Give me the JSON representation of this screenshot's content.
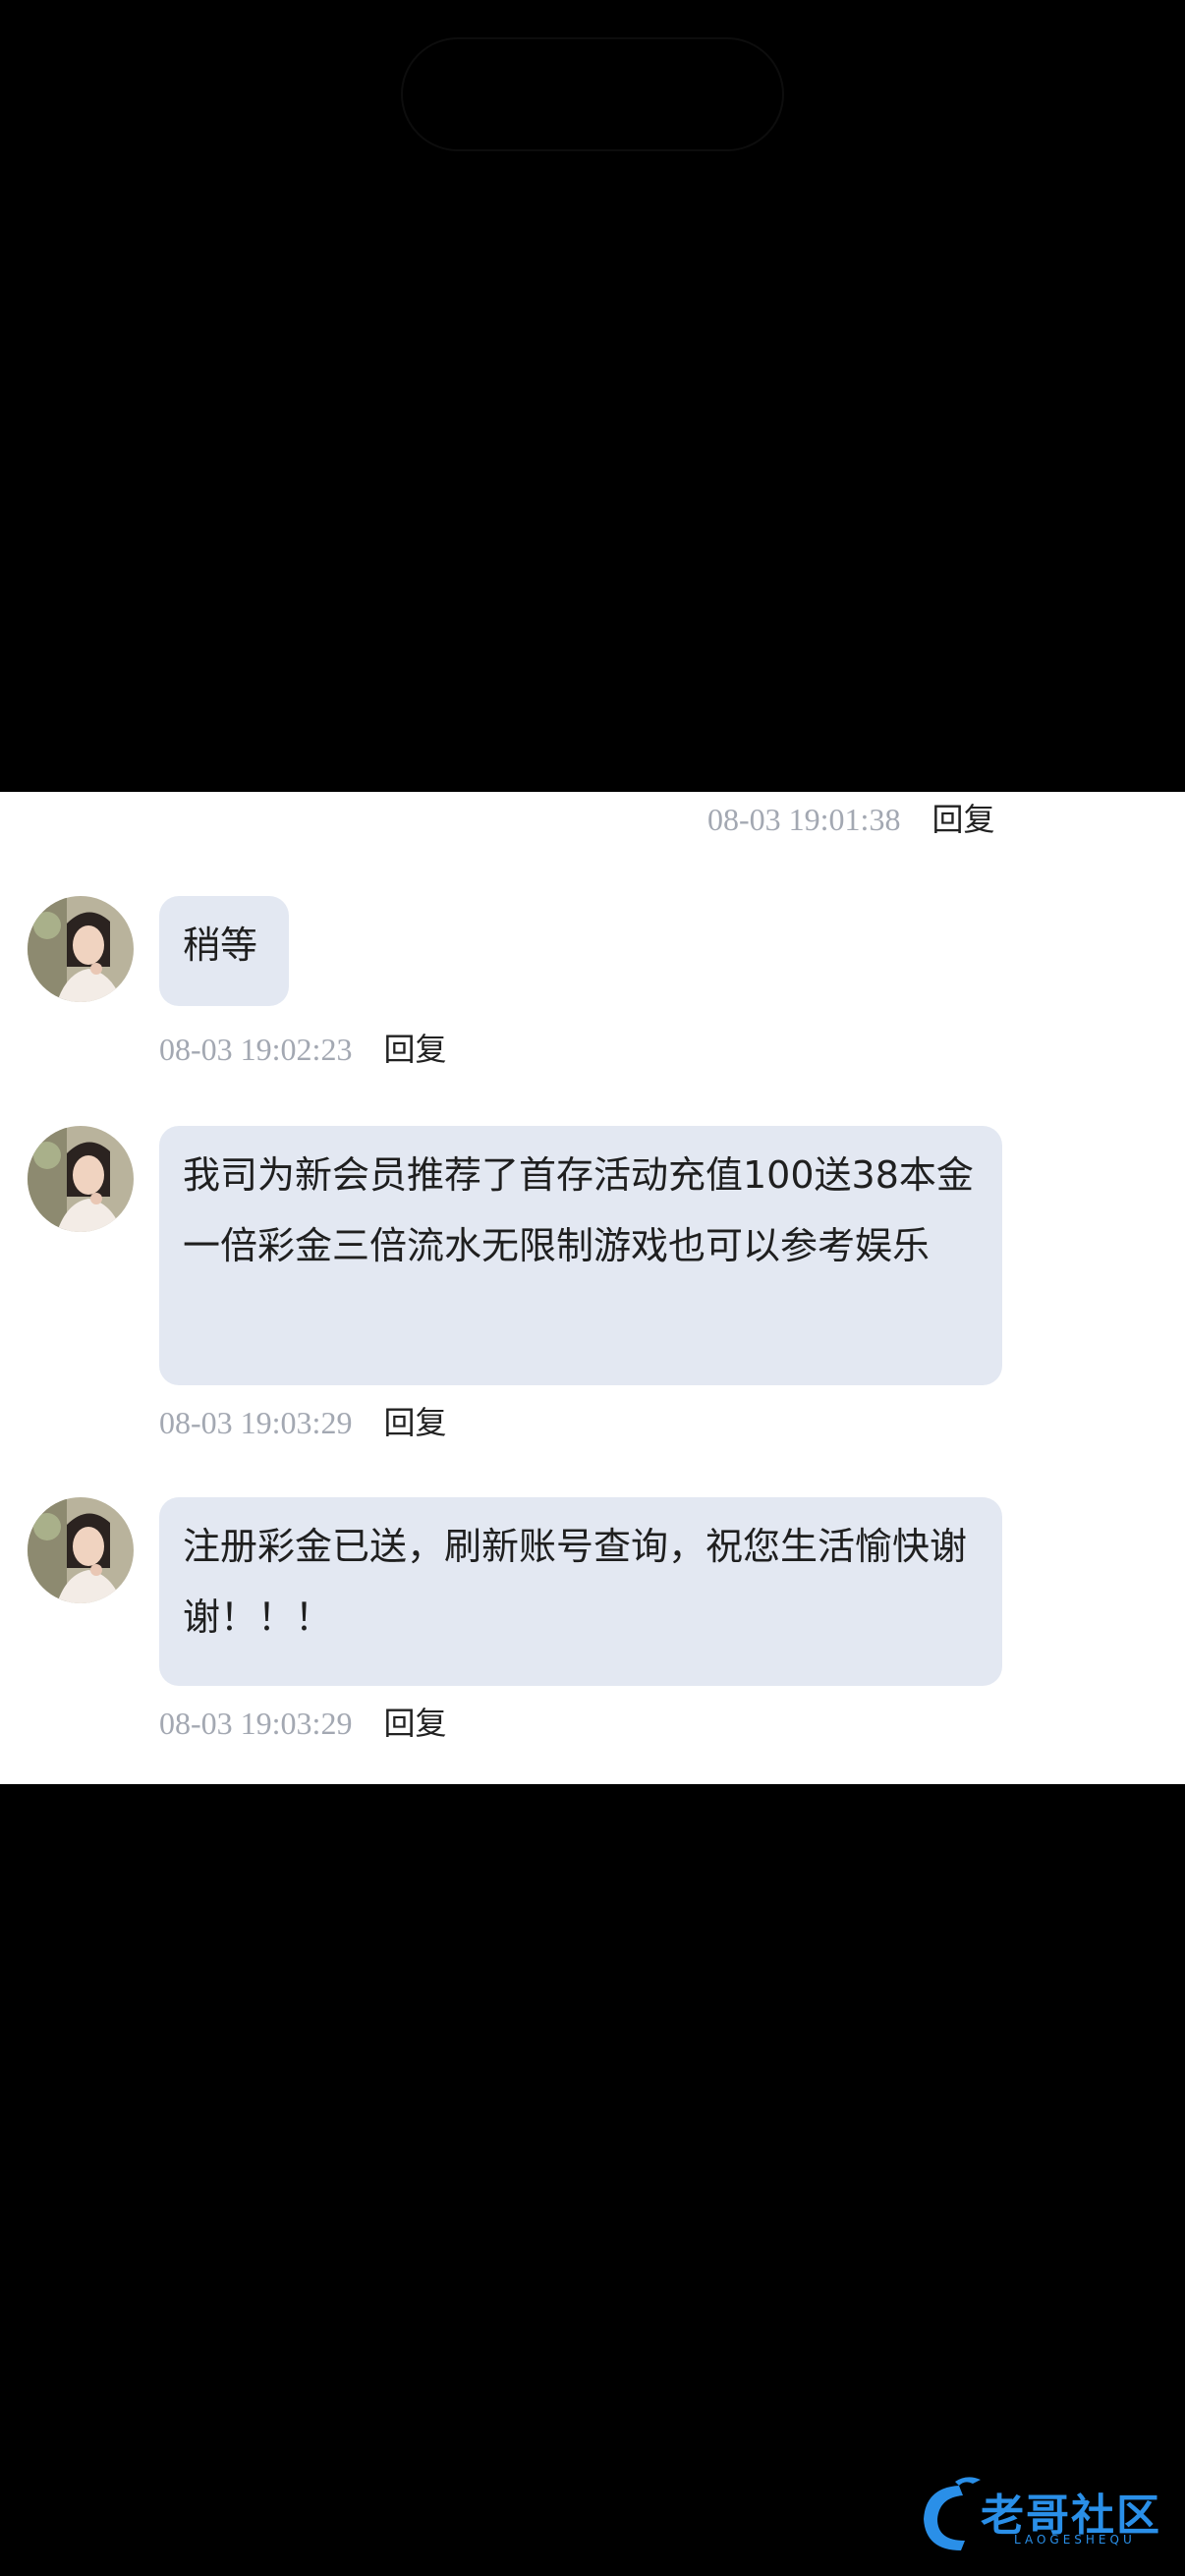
{
  "chat": {
    "top_meta": {
      "time": "08-03 19:01:38",
      "reply": "回复"
    },
    "messages": [
      {
        "text": "稍等",
        "time": "08-03 19:02:23",
        "reply": "回复"
      },
      {
        "text": "我司为新会员推荐了首存活动充值100送38本金一倍彩金三倍流水无限制游戏也可以参考娱乐",
        "time": "08-03 19:03:29",
        "reply": "回复"
      },
      {
        "text": "注册彩金已送，刷新账号查询，祝您生活愉快谢谢！！！",
        "time": "08-03 19:03:29",
        "reply": "回复"
      }
    ]
  },
  "watermark": {
    "text": "老哥社区",
    "subtext": "LAOGESHEQU",
    "icon": "dragon-logo-icon",
    "color": "#2a8fe8"
  },
  "colors": {
    "bubble": "#e3e8f2",
    "timestamp": "#a3a8b2",
    "panel": "#ffffff",
    "background": "#000000"
  }
}
